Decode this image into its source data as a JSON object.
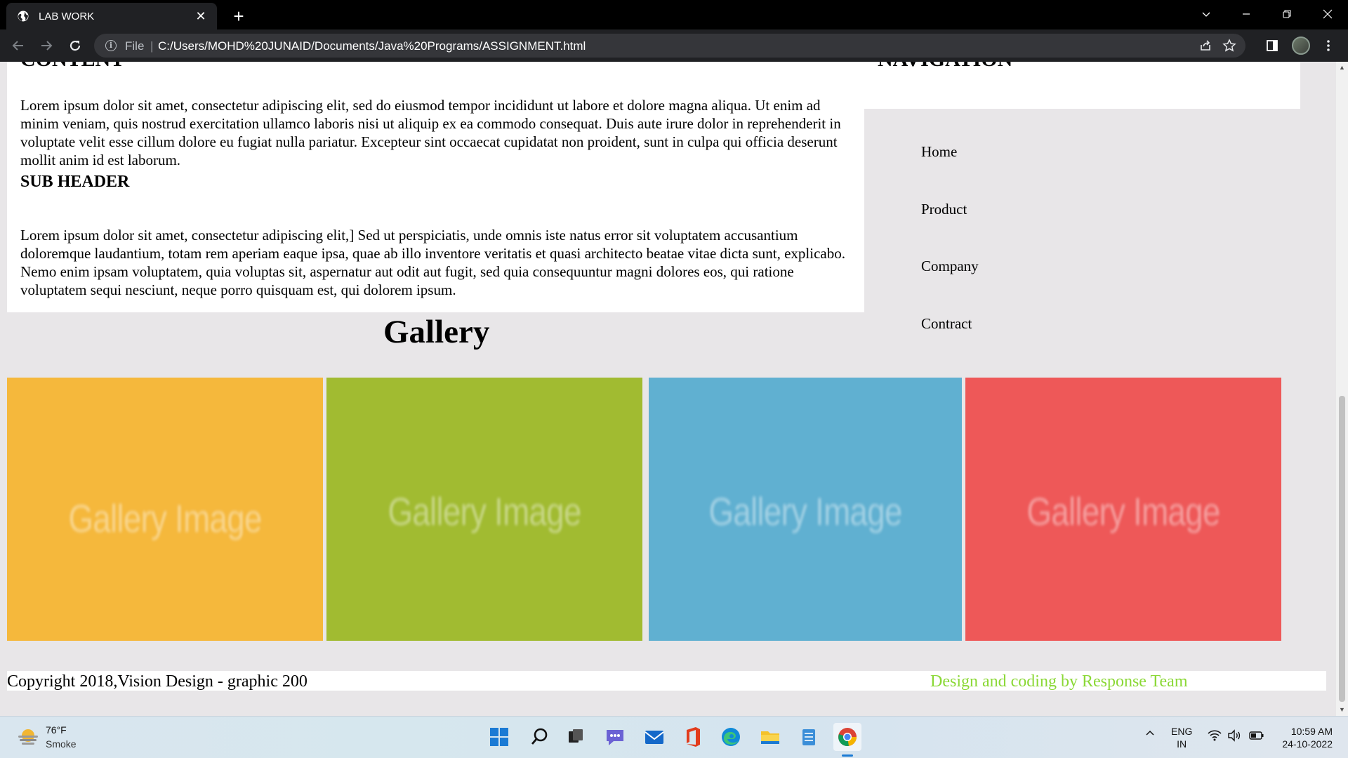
{
  "browser": {
    "tab_title": "LAB WORK",
    "tab_close": "✕",
    "new_tab": "+",
    "scheme_label": "File",
    "separator": "|",
    "url": "C:/Users/MOHD%20JUNAID/Documents/Java%20Programs/ASSIGNMENT.html"
  },
  "page": {
    "content_heading": "CONTENT",
    "para1": "Lorem ipsum dolor sit amet, consectetur adipiscing elit, sed do eiusmod tempor incididunt ut labore et dolore magna aliqua. Ut enim ad minim veniam, quis nostrud exercitation ullamco laboris nisi ut aliquip ex ea commodo consequat. Duis aute irure dolor in reprehenderit in voluptate velit esse cillum dolore eu fugiat nulla pariatur. Excepteur sint occaecat cupidatat non proident, sunt in culpa qui officia deserunt mollit anim id est laborum.",
    "sub_header": "SUB HEADER",
    "para2": "Lorem ipsum dolor sit amet, consectetur adipiscing elit,] Sed ut perspiciatis, unde omnis iste natus error sit voluptatem accusantium doloremque laudantium, totam rem aperiam eaque ipsa, quae ab illo inventore veritatis et quasi architecto beatae vitae dicta sunt, explicabo. Nemo enim ipsam voluptatem, quia voluptas sit, aspernatur aut odit aut fugit, sed quia consequuntur magni dolores eos, qui ratione voluptatem sequi nesciunt, neque porro quisquam est, qui dolorem ipsum.",
    "nav_heading": "NAVIGATION",
    "nav_items": [
      "Home",
      "Product",
      "Company",
      "Contract"
    ],
    "gallery_title": "Gallery",
    "gallery": [
      {
        "label": "Gallery Image",
        "color": "#f5b83c"
      },
      {
        "label": "Gallery Image",
        "color": "#a1bb31"
      },
      {
        "label": "Gallery Image",
        "color": "#60b0d1"
      },
      {
        "label": "Gallery Image",
        "color": "#ee5858"
      }
    ],
    "footer_left": "Copyright 2018,Vision Design - graphic 200",
    "footer_right": "Design and coding by Response Team",
    "footer_right_color": "#8ad835"
  },
  "taskbar": {
    "temperature": "76°F",
    "condition": "Smoke",
    "lang_line1": "ENG",
    "lang_line2": "IN",
    "time": "10:59 AM",
    "date": "24-10-2022",
    "apps": [
      "start-icon",
      "search-icon",
      "task-view-icon",
      "teams-chat-icon",
      "mail-icon",
      "office-icon",
      "edge-icon",
      "file-explorer-icon",
      "notepad-icon",
      "chrome-icon"
    ]
  }
}
